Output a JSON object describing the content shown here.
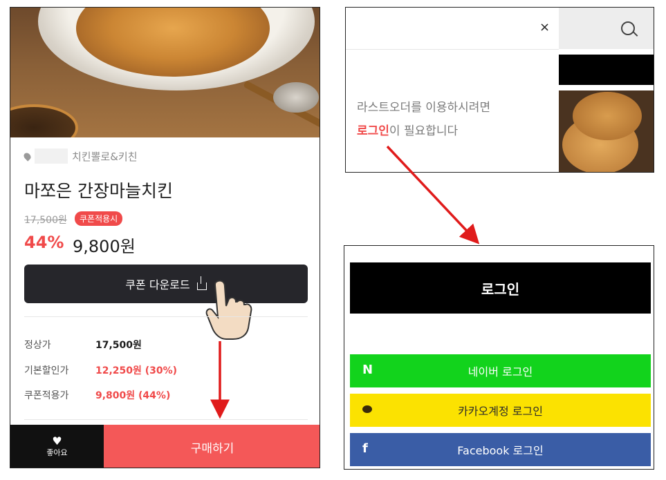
{
  "product_page": {
    "location": "치킨뽈로&키친",
    "title": "마쪼은 간장마늘치킨",
    "original_price": "17,500원",
    "coupon_badge": "쿠폰적용시",
    "discount_pct": "44%",
    "sale_price": "9,800원",
    "coupon_button": "쿠폰 다운로드",
    "rows": [
      {
        "label": "정상가",
        "value": "17,500원"
      },
      {
        "label": "기본할인가",
        "value": "12,250원 (30%)"
      },
      {
        "label": "쿠폰적용가",
        "value": "9,800원 (44%)"
      }
    ],
    "like_label": "좋아요",
    "buy_button": "구매하기"
  },
  "login_required": {
    "close": "×",
    "message_line1": "라스트오더를 이용하시려면",
    "message_highlight": "로그인",
    "message_line2_rest": "이 필요합니다"
  },
  "login_options": {
    "header": "로그인",
    "naver": {
      "icon": "N",
      "label": "네이버 로그인"
    },
    "kakao": {
      "label": "카카오계정 로그인"
    },
    "facebook": {
      "icon": "f",
      "label": "Facebook 로그인"
    }
  },
  "colors": {
    "accent_red": "#f04a4a",
    "buy_red": "#f45858",
    "naver_green": "#12d31c",
    "kakao_yellow": "#fbe201",
    "facebook_blue": "#3a5da6",
    "arrow_red": "#e01b1b"
  }
}
